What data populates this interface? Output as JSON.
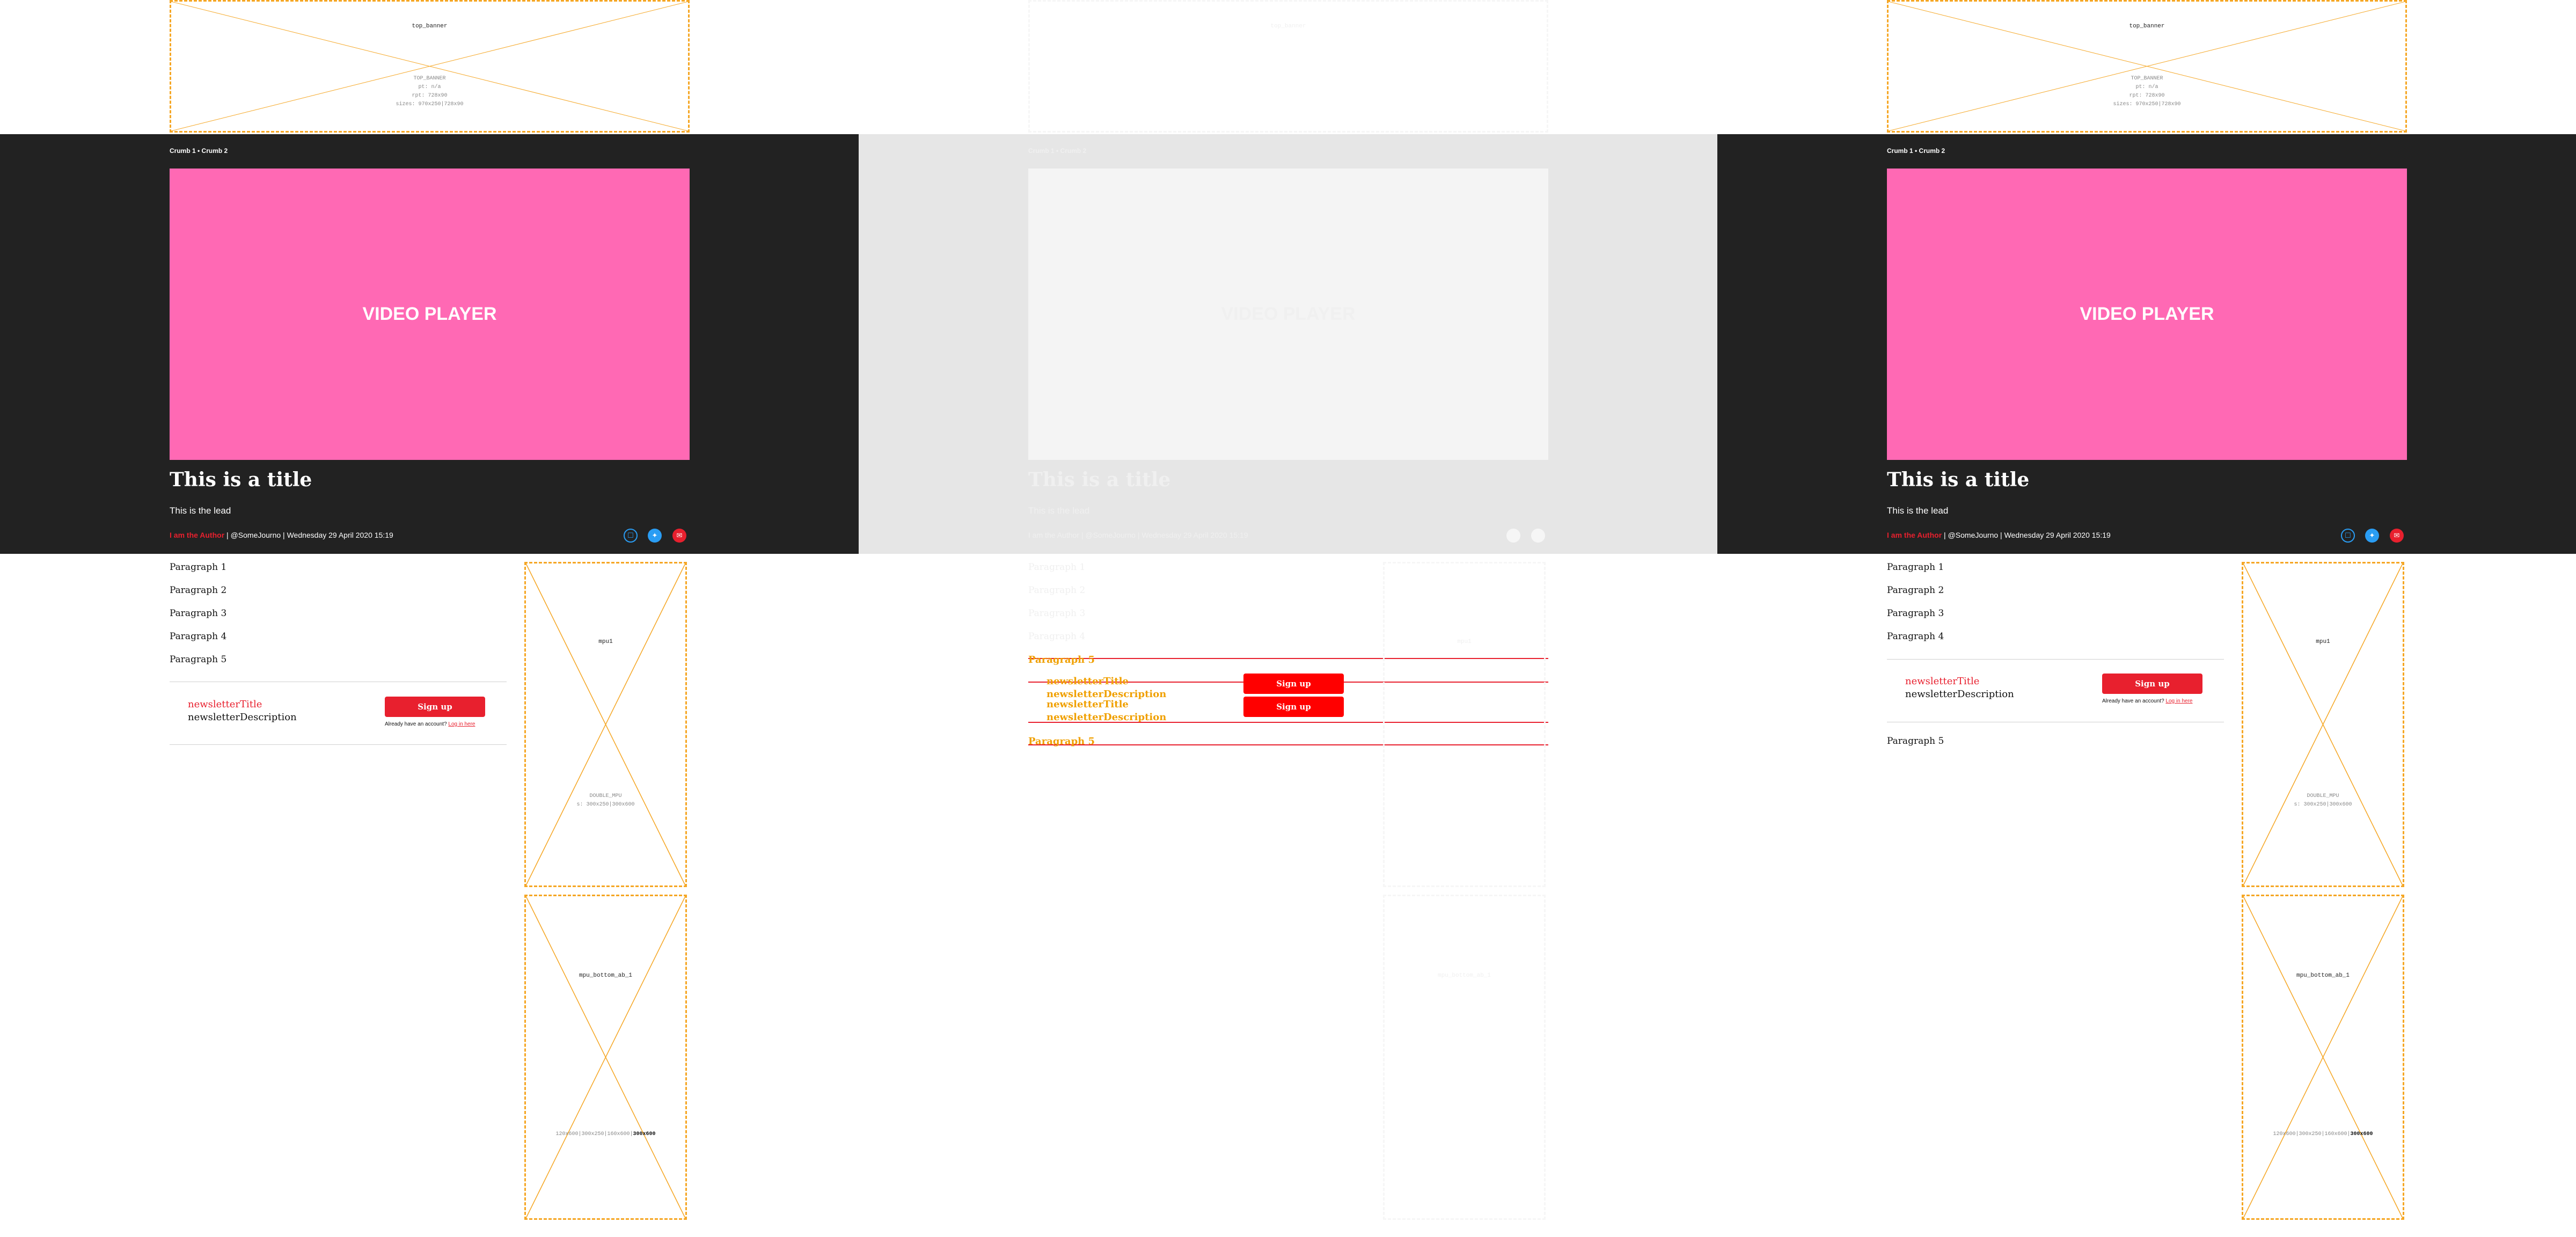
{
  "ads": {
    "top_banner": {
      "name": "top_banner",
      "meta_title": "TOP_BANNER",
      "meta_line1": "pt: n/a",
      "meta_line2": "rpt: 728x90",
      "meta_line3": "sizes: 970x250|728x90"
    },
    "mpu1": {
      "name": "mpu1",
      "meta_title": "DOUBLE_MPU",
      "meta_line1": "s: 300x250|300x600"
    },
    "mpu_bottom": {
      "name": "mpu_bottom_ab_1",
      "meta_sizes": "120x600|300x250|160x600|",
      "meta_bold": "300x600"
    }
  },
  "breadcrumb": "Crumb 1 • Crumb 2",
  "video_label": "VIDEO PLAYER",
  "title": "This is a title",
  "lead": "This is the lead",
  "byline": {
    "author": "I am the Author",
    "rest": " | @SomeJourno | Wednesday 29 April 2020 15:19"
  },
  "social": {
    "bookmark": "☐",
    "twitter": "✦",
    "email": "✉"
  },
  "paragraphs": [
    "Paragraph 1",
    "Paragraph 2",
    "Paragraph 3",
    "Paragraph 4",
    "Paragraph 5"
  ],
  "newsletter": {
    "title": "newsletterTitle",
    "description": "newsletterDescription",
    "button": "Sign up",
    "login_text": "Already have an account? ",
    "login_link": "Log in here"
  },
  "colors": {
    "accent": "#e8202e",
    "video": "#ff69b4",
    "hero": "#222222",
    "ad_border": "#f5a623",
    "twitter": "#2a9df4"
  }
}
